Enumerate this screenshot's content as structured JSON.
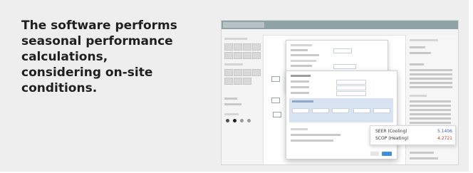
{
  "caption": {
    "lines": [
      "The software performs",
      "seasonal performance",
      "calculations,",
      "considering on-site",
      "conditions."
    ]
  },
  "results": {
    "seer_label": "SEER (Cooling)",
    "seer_value": "5.1406",
    "scop_label": "SCOP (Heating)",
    "scop_value": "4.2721",
    "seer_color": "#3a5fb0",
    "scop_color": "#c0392b"
  },
  "colors": {
    "background": "#eeeeee",
    "caption_text": "#1f1f1f",
    "accent_blue": "#3f8ee0"
  }
}
